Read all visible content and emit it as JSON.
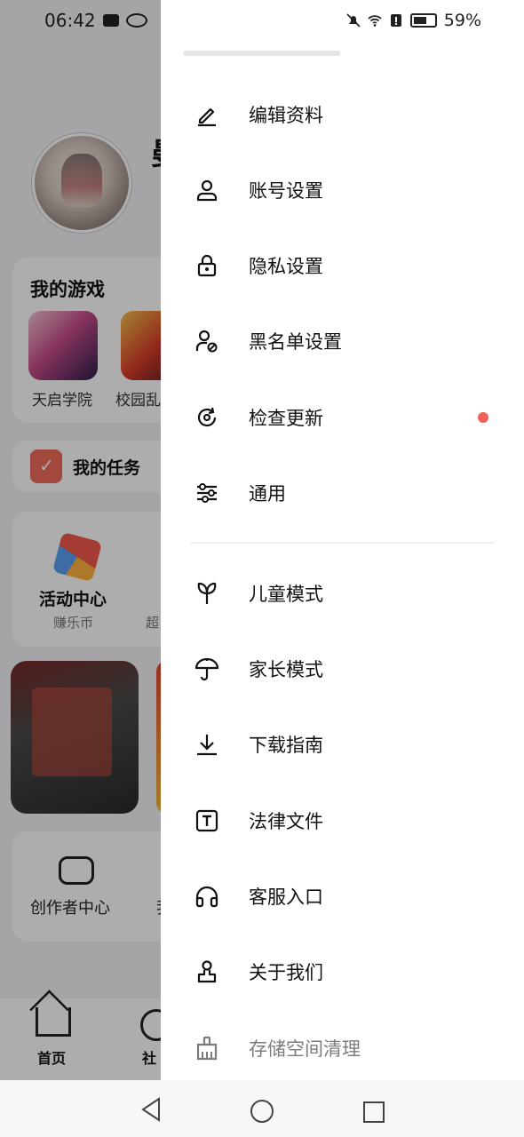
{
  "status_bar": {
    "time": "06:42",
    "battery": "59%"
  },
  "background": {
    "name_peek": "曼",
    "games_title": "我的游戏",
    "games": [
      "天启学院",
      "校园乱"
    ],
    "task_label": "我的任务",
    "activity": {
      "title": "活动中心",
      "subtitle": "赚乐币",
      "subtitle2": "超"
    },
    "creator_label": "创作者中心",
    "creator_peek": "我",
    "nav": {
      "home": "首页",
      "community": "社"
    }
  },
  "drawer": {
    "items_group1": [
      {
        "label": "编辑资料",
        "icon": "edit-icon"
      },
      {
        "label": "账号设置",
        "icon": "user-icon"
      },
      {
        "label": "隐私设置",
        "icon": "lock-icon"
      },
      {
        "label": "黑名单设置",
        "icon": "user-blocked-icon"
      },
      {
        "label": "检查更新",
        "icon": "refresh-icon",
        "badge": true
      },
      {
        "label": "通用",
        "icon": "sliders-icon"
      }
    ],
    "items_group2": [
      {
        "label": "儿童模式",
        "icon": "sprout-icon"
      },
      {
        "label": "家长模式",
        "icon": "umbrella-icon"
      },
      {
        "label": "下载指南",
        "icon": "download-icon"
      },
      {
        "label": "法律文件",
        "icon": "document-t-icon"
      },
      {
        "label": "客服入口",
        "icon": "headphones-icon"
      },
      {
        "label": "关于我们",
        "icon": "about-icon"
      },
      {
        "label": "存储空间清理",
        "icon": "broom-icon"
      }
    ],
    "badge_color": "#f0605a"
  }
}
